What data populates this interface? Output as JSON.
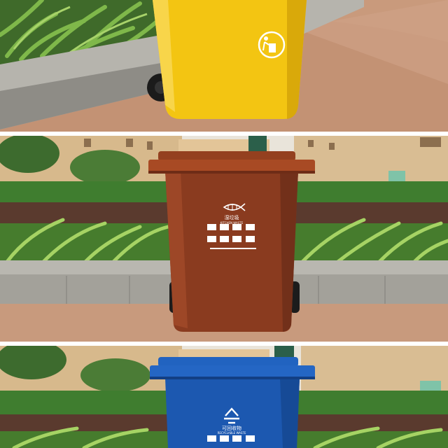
{
  "image": {
    "panels": [
      {
        "bin_color": "yellow",
        "hex": "#F3C512",
        "icon": "person-tossing-trash-icon"
      },
      {
        "bin_color": "brown",
        "hex": "#8A3B1F",
        "label_cn": "湿垃圾",
        "label_en": "KITCHEN WASTE",
        "icon": "fish-bone-icon"
      },
      {
        "bin_color": "blue",
        "hex": "#1C58B0",
        "label_cn": "可回收物",
        "label_en": "RECYCLABLE WASTE",
        "icon": "recycle-icon"
      }
    ]
  }
}
